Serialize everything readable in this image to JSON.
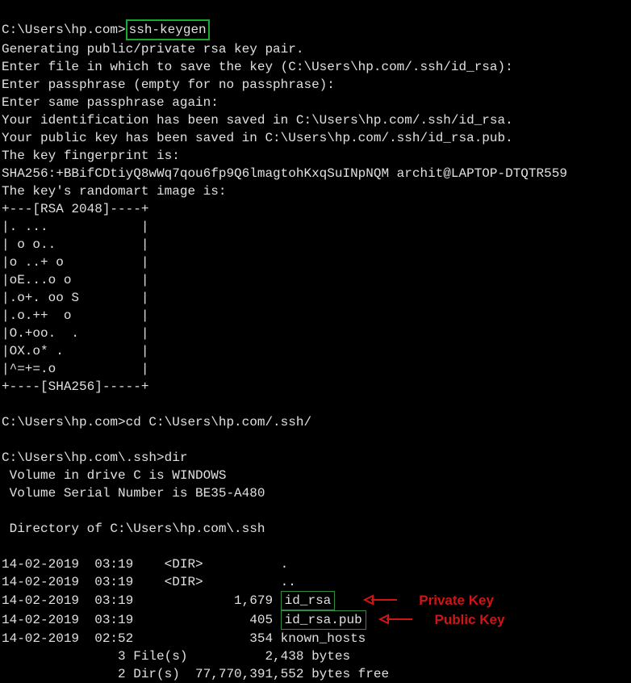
{
  "prompt1": "C:\\Users\\hp.com>",
  "cmd1": "ssh-keygen",
  "out1": "Generating public/private rsa key pair.",
  "out2": "Enter file in which to save the key (C:\\Users\\hp.com/.ssh/id_rsa):",
  "out3": "Enter passphrase (empty for no passphrase):",
  "out4": "Enter same passphrase again:",
  "out5": "Your identification has been saved in C:\\Users\\hp.com/.ssh/id_rsa.",
  "out6": "Your public key has been saved in C:\\Users\\hp.com/.ssh/id_rsa.pub.",
  "out7": "The key fingerprint is:",
  "out8": "SHA256:+BBifCDtiyQ8wWq7qou6fp9Q6lmagtohKxqSuINpNQM archit@LAPTOP-DTQTR559",
  "out9": "The key's randomart image is:",
  "art": [
    "+---[RSA 2048]----+",
    "|. ...            |",
    "| o o..           |",
    "|o ..+ o          |",
    "|oE...o o         |",
    "|.o+. oo S        |",
    "|.o.++  o         |",
    "|O.+oo.  .        |",
    "|OX.o* .          |",
    "|^=+=.o           |",
    "+----[SHA256]-----+"
  ],
  "prompt2": "C:\\Users\\hp.com>",
  "cmd2": "cd C:\\Users\\hp.com/.ssh/",
  "prompt3": "C:\\Users\\hp.com\\.ssh>",
  "cmd3": "dir",
  "dir1": " Volume in drive C is WINDOWS",
  "dir2": " Volume Serial Number is BE35-A480",
  "dir3": " Directory of C:\\Users\\hp.com\\.ssh",
  "d_row1": "14-02-2019  03:19    <DIR>          .",
  "d_row2": "14-02-2019  03:19    <DIR>          ..",
  "d_row3_pre": "14-02-2019  03:19             1,679 ",
  "d_row3_name": "id_rsa",
  "d_row4_pre": "14-02-2019  03:19               405 ",
  "d_row4_name": "id_rsa.pub",
  "d_row5": "14-02-2019  02:52               354 known_hosts",
  "d_sum1": "               3 File(s)          2,438 bytes",
  "d_sum2": "               2 Dir(s)  77,770,391,552 bytes free",
  "label_private": "Private Key",
  "label_public": "Public Key"
}
